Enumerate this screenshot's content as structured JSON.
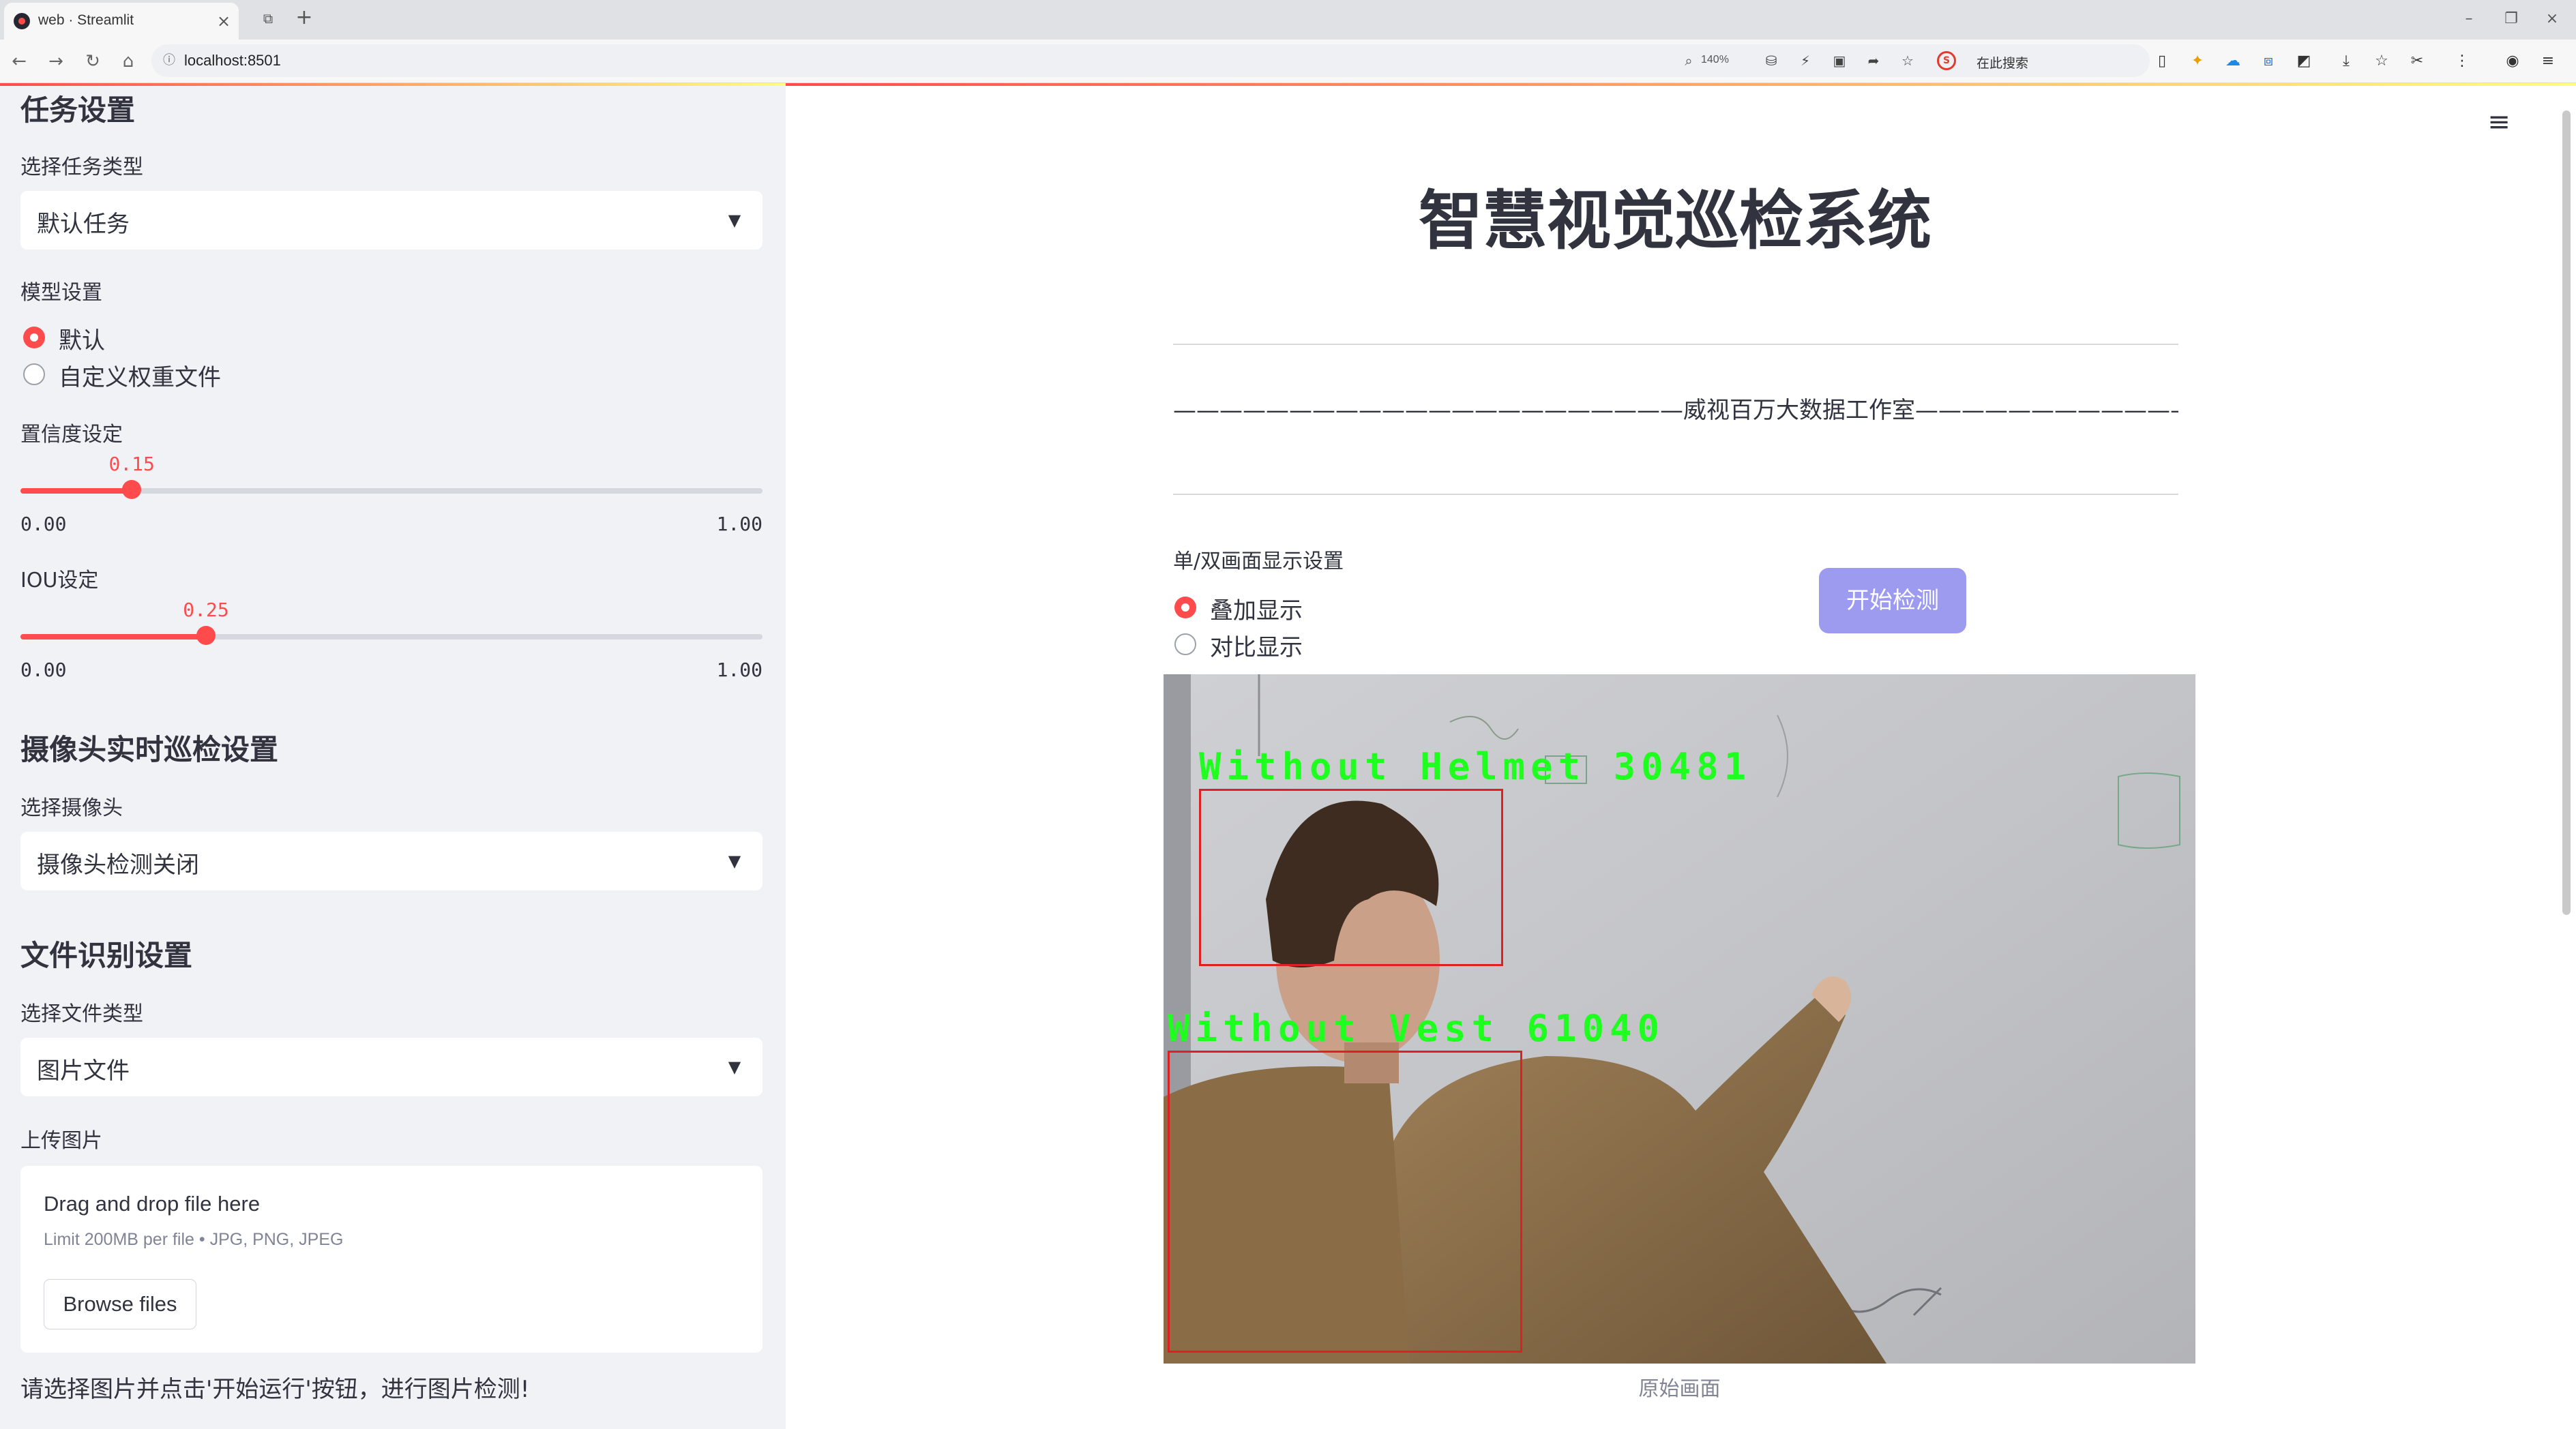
{
  "browser": {
    "tab_title": "web · Streamlit",
    "address": "localhost:8501",
    "zoom": "140%",
    "search_placeholder": "在此搜索"
  },
  "sidebar": {
    "task_header": "任务设置",
    "task_type_label": "选择任务类型",
    "task_type_value": "默认任务",
    "model_label": "模型设置",
    "model_options": [
      "默认",
      "自定义权重文件"
    ],
    "model_selected_index": 0,
    "confidence": {
      "label": "置信度设定",
      "value": 0.15,
      "value_text": "0.15",
      "min": "0.00",
      "max": "1.00"
    },
    "iou": {
      "label": "IOU设定",
      "value": 0.25,
      "value_text": "0.25",
      "min": "0.00",
      "max": "1.00"
    },
    "camera_header": "摄像头实时巡检设置",
    "camera_label": "选择摄像头",
    "camera_value": "摄像头检测关闭",
    "file_header": "文件识别设置",
    "file_type_label": "选择文件类型",
    "file_type_value": "图片文件",
    "upload_label": "上传图片",
    "uploader": {
      "drop_title": "Drag and drop file here",
      "limit": "Limit 200MB per file • JPG, PNG, JPEG",
      "browse_label": "Browse files"
    },
    "hint": "请选择图片并点击'开始运行'按钮，进行图片检测!"
  },
  "main": {
    "title": "智慧视觉巡检系统",
    "banner": "——————————————————————威视百万大数据工作室———————————————————————",
    "display_mode_label": "单/双画面显示设置",
    "display_modes": [
      "叠加显示",
      "对比显示"
    ],
    "display_mode_selected_index": 0,
    "start_button": "开始检测",
    "caption": "原始画面",
    "detections": [
      {
        "label": "Without Helmet 30481"
      },
      {
        "label": "Without Vest 61040"
      }
    ]
  },
  "colors": {
    "accent": "#ff4b4b",
    "sidebar_bg": "#f0f2f6",
    "button_bg": "#9d9bf0",
    "box_color": "#e02020",
    "label_color": "#1fff1f"
  }
}
